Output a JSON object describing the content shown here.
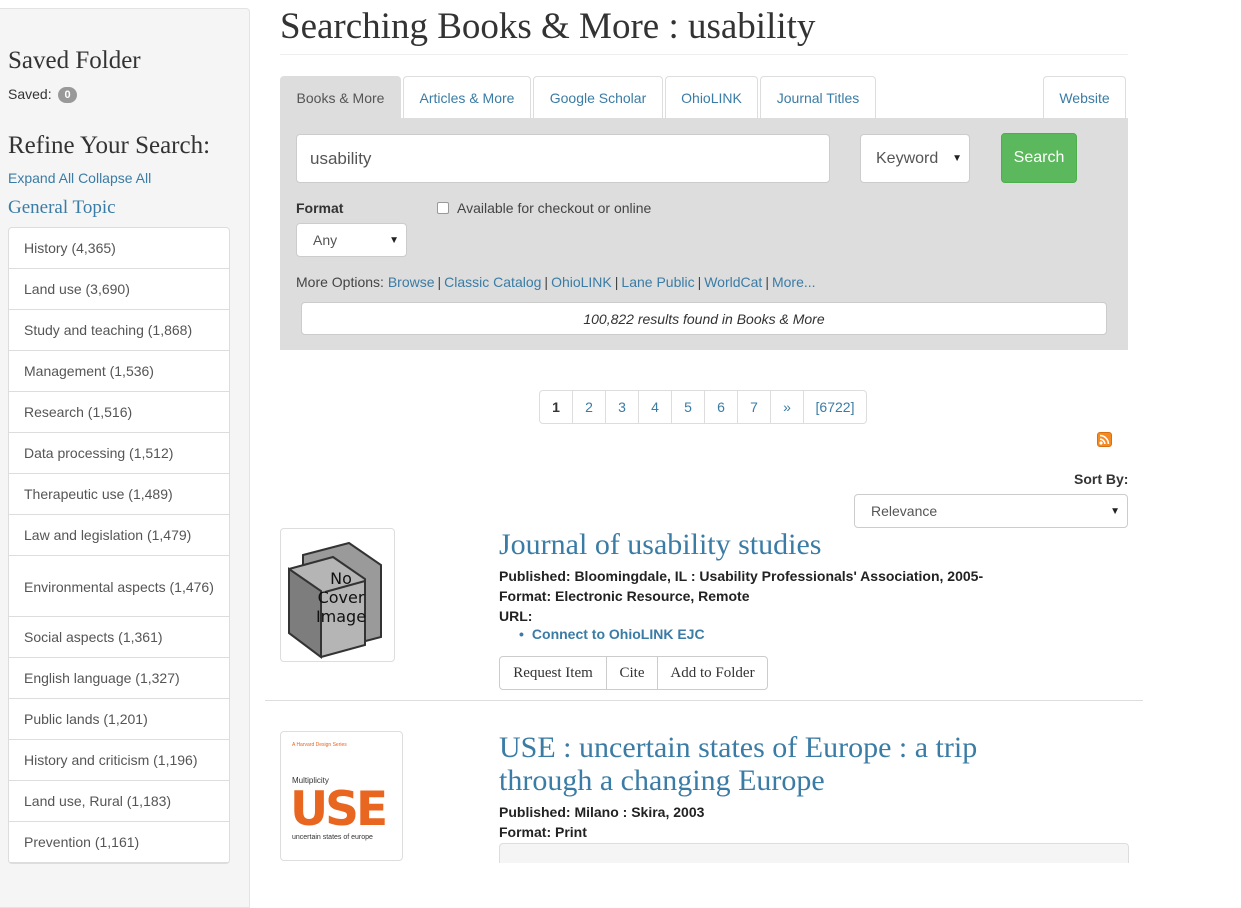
{
  "sidebar": {
    "saved_folder_title": "Saved Folder",
    "saved_label": "Saved:",
    "saved_count": "0",
    "refine_title": "Refine Your Search:",
    "expand_all": "Expand All",
    "collapse_all": "Collapse All",
    "general_topic": "General Topic",
    "topics": [
      "History (4,365)",
      "Land use (3,690)",
      "Study and teaching (1,868)",
      "Management (1,536)",
      "Research (1,516)",
      "Data processing (1,512)",
      "Therapeutic use (1,489)",
      "Law and legislation (1,479)",
      "Environmental aspects (1,476)",
      "Social aspects (1,361)",
      "English language (1,327)",
      "Public lands (1,201)",
      "History and criticism (1,196)",
      "Land use, Rural (1,183)",
      "Prevention (1,161)"
    ]
  },
  "header": {
    "title": "Searching Books & More : usability"
  },
  "tabs": [
    "Books & More",
    "Articles & More",
    "Google Scholar",
    "OhioLINK",
    "Journal Titles",
    "Website"
  ],
  "search": {
    "query": "usability",
    "search_type": "Keyword",
    "button_label": "Search",
    "format_label": "Format",
    "format_value": "Any",
    "available_label": "Available for checkout or online",
    "more_options_label": "More Options:",
    "more_options": [
      "Browse",
      "Classic Catalog",
      "OhioLINK",
      "Lane Public",
      "WorldCat",
      "More..."
    ],
    "results_count": "100,822 results found in Books & More"
  },
  "pagination": [
    "1",
    "2",
    "3",
    "4",
    "5",
    "6",
    "7",
    "»",
    "[6722]"
  ],
  "sort": {
    "label": "Sort By:",
    "value": "Relevance"
  },
  "results": [
    {
      "title": "Journal of usability studies",
      "cover_text": "No Cover Image",
      "published": "Published: Bloomingdale, IL : Usability Professionals' Association, 2005-",
      "format": "Format: Electronic Resource, Remote",
      "url_label": "URL:",
      "url_link": "Connect to OhioLINK EJC",
      "actions": [
        "Request Item",
        "Cite",
        "Add to Folder"
      ]
    },
    {
      "title": "USE : uncertain states of Europe : a trip through a changing Europe",
      "cover_small": "A Harvard Design Series",
      "cover_series": "Multiplicity",
      "cover_big": "USE",
      "cover_sub": "uncertain states of europe",
      "published": "Published: Milano : Skira, 2003",
      "format": "Format: Print"
    }
  ],
  "colors": {
    "link": "#3a7ca5",
    "search_button": "#5cb85c",
    "panel": "#dddddd",
    "rss": "#f58a1f",
    "use_cover_orange": "#e8661f"
  }
}
